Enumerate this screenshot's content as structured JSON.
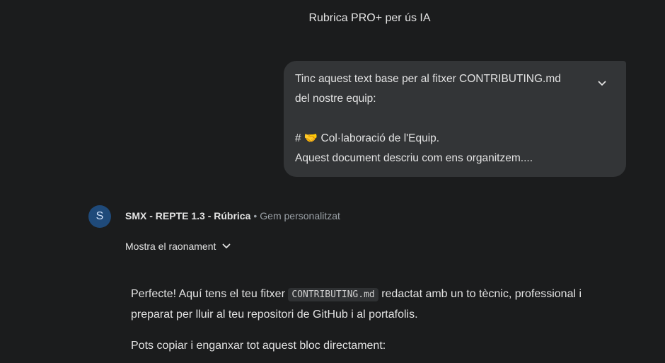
{
  "chat": {
    "title": "Rubrica PRO+ per ús IA"
  },
  "user_message": {
    "lines": [
      "Tinc aquest text base per al fitxer CONTRIBUTING.md",
      "del nostre equip:",
      "",
      "# 🤝 Col·laboració de l'Equip.",
      "Aquest document descriu com ens organitzem...."
    ],
    "expand_icon": "chevron-down-icon"
  },
  "response": {
    "avatar_letter": "S",
    "gem_name": "SMX - REPTE 1.3 - Rúbrica",
    "separator": "•",
    "gem_type": "Gem personalitzat",
    "reasoning_label": "Mostra el raonament",
    "paragraph1_before": "Perfecte! Aquí tens el teu fitxer ",
    "paragraph1_code": "CONTRIBUTING.md",
    "paragraph1_after": " redactat amb un to tècnic, professional i preparat per lluir al teu repositori de GitHub i al portafolis.",
    "paragraph2": "Pots copiar i enganxar tot aquest bloc directament:"
  },
  "colors": {
    "background": "#1b1c1d",
    "bubble": "#333537",
    "avatar": "#1f4a7a",
    "text": "#e3e3e3",
    "muted": "#9aa0a6"
  }
}
